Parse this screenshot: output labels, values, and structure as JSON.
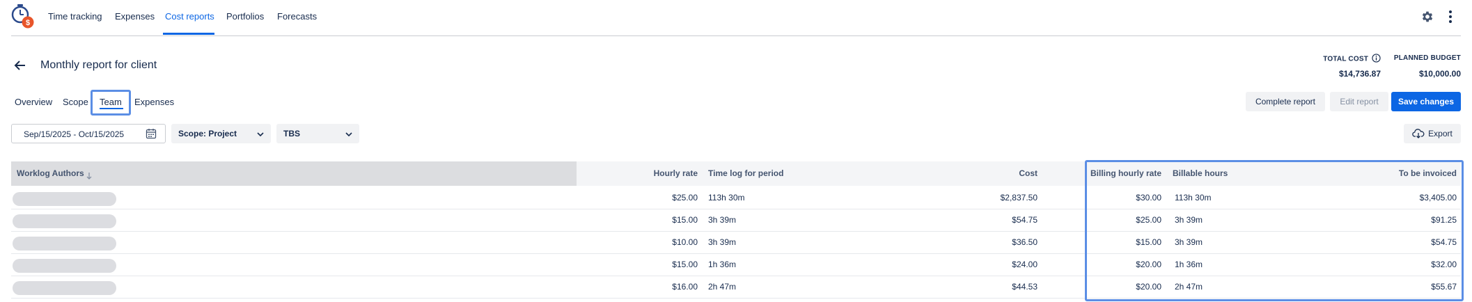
{
  "nav": {
    "items": [
      {
        "label": "Time tracking",
        "active": false
      },
      {
        "label": "Expenses",
        "active": false
      },
      {
        "label": "Cost reports",
        "active": true
      },
      {
        "label": "Portfolios",
        "active": false
      },
      {
        "label": "Forecasts",
        "active": false
      }
    ],
    "logo_symbol": "$"
  },
  "header": {
    "title": "Monthly report for client",
    "total_cost_label": "TOTAL COST",
    "total_cost_value": "$14,736.87",
    "planned_budget_label": "PLANNED BUDGET",
    "planned_budget_value": "$10,000.00"
  },
  "tabs": [
    {
      "label": "Overview"
    },
    {
      "label": "Scope"
    },
    {
      "label": "Team",
      "active": true
    },
    {
      "label": "Expenses"
    }
  ],
  "actions": {
    "complete_report": "Complete report",
    "edit_report": "Edit report",
    "save_changes": "Save changes",
    "export": "Export"
  },
  "filters": {
    "date_range": "Sep/15/2025 - Oct/15/2025",
    "scope": "Scope: Project",
    "hierarchy": "TBS"
  },
  "table": {
    "headers": {
      "authors": "Worklog Authors",
      "hourly_rate": "Hourly rate",
      "time_log": "Time log for period",
      "cost": "Cost",
      "billing_rate": "Billing hourly rate",
      "billable_hours": "Billable hours",
      "to_be_invoiced": "To be invoiced"
    },
    "rows": [
      {
        "hourly_rate": "$25.00",
        "time_log": "113h 30m",
        "cost": "$2,837.50",
        "billing_rate": "$30.00",
        "billable_hours": "113h 30m",
        "invoiced": "$3,405.00"
      },
      {
        "hourly_rate": "$15.00",
        "time_log": "3h 39m",
        "cost": "$54.75",
        "billing_rate": "$25.00",
        "billable_hours": "3h 39m",
        "invoiced": "$91.25"
      },
      {
        "hourly_rate": "$10.00",
        "time_log": "3h 39m",
        "cost": "$36.50",
        "billing_rate": "$15.00",
        "billable_hours": "3h 39m",
        "invoiced": "$54.75"
      },
      {
        "hourly_rate": "$15.00",
        "time_log": "1h 36m",
        "cost": "$24.00",
        "billing_rate": "$20.00",
        "billable_hours": "1h 36m",
        "invoiced": "$32.00"
      },
      {
        "hourly_rate": "$16.00",
        "time_log": "2h 47m",
        "cost": "$44.53",
        "billing_rate": "$20.00",
        "billable_hours": "2h 47m",
        "invoiced": "$55.67"
      }
    ]
  },
  "colors": {
    "accent": "#0c66e4",
    "highlight": "#5b8ee5",
    "logo_orange": "#e8552a"
  }
}
